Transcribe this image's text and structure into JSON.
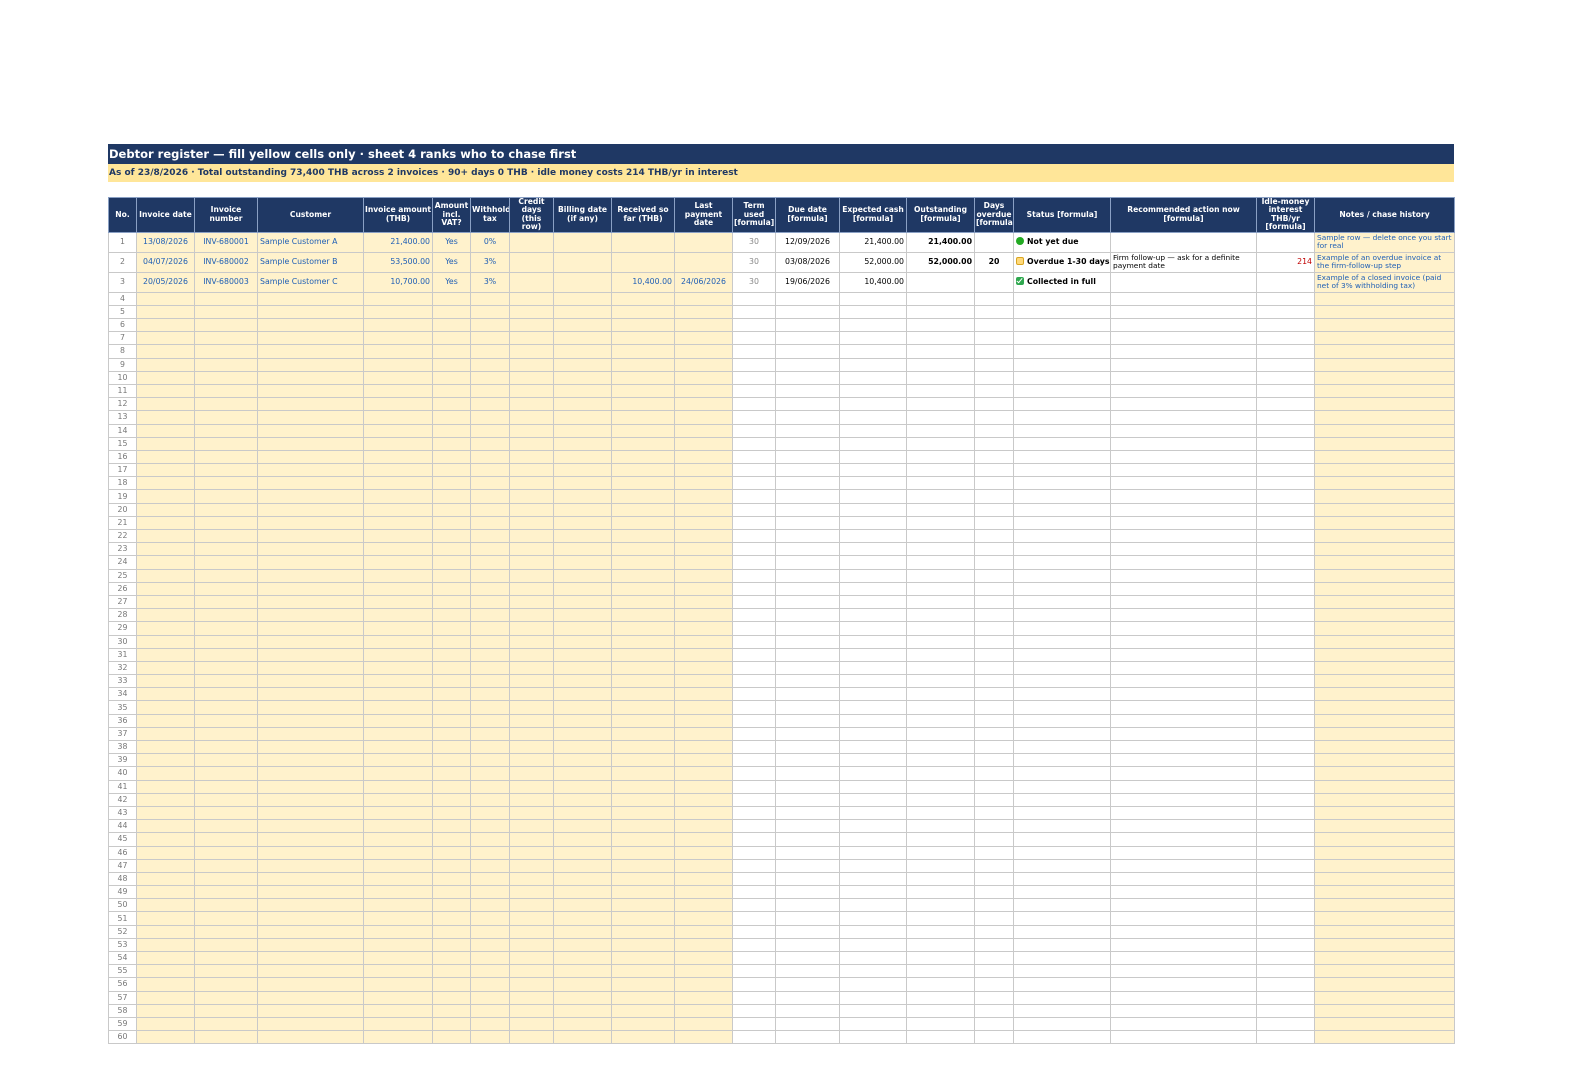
{
  "title": "Debtor register — fill yellow cells only · sheet 4 ranks who to chase first",
  "summary": "As of 23/8/2026  ·  Total outstanding 73,400 THB across 2 invoices · 90+ days 0 THB · idle money costs 214 THB/yr in interest",
  "headers": [
    "No.",
    "Invoice date",
    "Invoice number",
    "Customer",
    "Invoice amount (THB)",
    "Amount incl. VAT?",
    "Withholding tax",
    "Credit days (this row)",
    "Billing date (if any)",
    "Received so far (THB)",
    "Last payment date",
    "Term used [formula]",
    "Due date [formula]",
    "Expected cash [formula]",
    "Outstanding [formula]",
    "Days overdue [formula]",
    "Status [formula]",
    "Recommended action now [formula]",
    "Idle-money interest THB/yr [formula]",
    "Notes / chase history"
  ],
  "rows": [
    {
      "no": "1",
      "invoice_date": "13/08/2026",
      "invoice_number": "INV-680001",
      "customer": "Sample Customer A",
      "amount": "21,400.00",
      "vat": "Yes",
      "wht": "0%",
      "credit_days": "",
      "billing_date": "",
      "received": "",
      "last_payment": "",
      "term": "30",
      "due_date": "12/09/2026",
      "expected_cash": "21,400.00",
      "outstanding": "21,400.00",
      "days_overdue": "",
      "status_icon": "green-dot-icon",
      "status": "Not yet due",
      "action": "",
      "interest": "",
      "notes": "Sample row — delete once you start for real"
    },
    {
      "no": "2",
      "invoice_date": "04/07/2026",
      "invoice_number": "INV-680002",
      "customer": "Sample Customer B",
      "amount": "53,500.00",
      "vat": "Yes",
      "wht": "3%",
      "credit_days": "",
      "billing_date": "",
      "received": "",
      "last_payment": "",
      "term": "30",
      "due_date": "03/08/2026",
      "expected_cash": "52,000.00",
      "outstanding": "52,000.00",
      "days_overdue": "20",
      "status_icon": "amber-square-icon",
      "status": "Overdue 1-30 days",
      "action": "Firm follow-up — ask for a definite payment date",
      "interest": "214",
      "notes": "Example of an overdue invoice at the firm-follow-up step"
    },
    {
      "no": "3",
      "invoice_date": "20/05/2026",
      "invoice_number": "INV-680003",
      "customer": "Sample Customer C",
      "amount": "10,700.00",
      "vat": "Yes",
      "wht": "3%",
      "credit_days": "",
      "billing_date": "",
      "received": "10,400.00",
      "last_payment": "24/06/2026",
      "term": "30",
      "due_date": "19/06/2026",
      "expected_cash": "10,400.00",
      "outstanding": "",
      "days_overdue": "",
      "status_icon": "green-check-icon",
      "status": "Collected in full",
      "action": "",
      "interest": "",
      "notes": "Example of a closed invoice (paid net of 3% withholding tax)"
    }
  ],
  "empty_rows": [
    "4",
    "5",
    "6",
    "7",
    "8",
    "9",
    "10",
    "11",
    "12",
    "13",
    "14",
    "15",
    "16",
    "17",
    "18",
    "19",
    "20",
    "21",
    "22",
    "23",
    "24",
    "25",
    "26",
    "27",
    "28",
    "29",
    "30",
    "31",
    "32",
    "33",
    "34",
    "35",
    "36",
    "37",
    "38",
    "39",
    "40",
    "41",
    "42",
    "43",
    "44",
    "45",
    "46",
    "47",
    "48",
    "49",
    "50",
    "51",
    "52",
    "53",
    "54",
    "55",
    "56",
    "57",
    "58",
    "59",
    "60"
  ],
  "colors": {
    "header_bg": "#1f3864",
    "input_cell": "#fff2cc",
    "summary_bg": "#ffe699",
    "input_text": "#1f5fb5"
  }
}
